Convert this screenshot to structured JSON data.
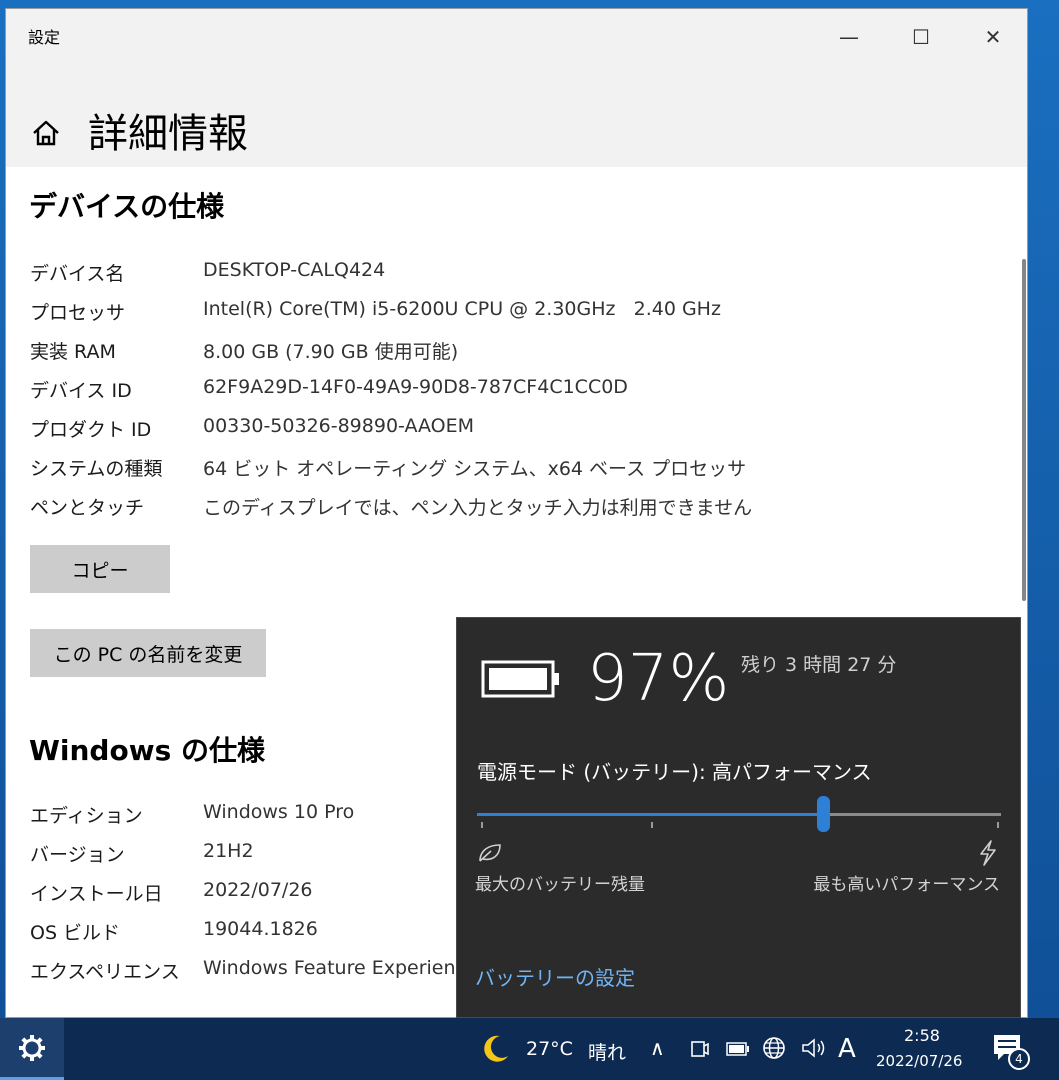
{
  "window": {
    "title": "設定",
    "minimize": "—",
    "maximize": "☐",
    "close": "✕"
  },
  "page": {
    "title": "詳細情報",
    "home_icon": "home-icon"
  },
  "device_spec": {
    "heading": "デバイスの仕様",
    "rows": [
      {
        "label": "デバイス名",
        "value": "DESKTOP-CALQ424"
      },
      {
        "label": "プロセッサ",
        "value": "Intel(R) Core(TM) i5-6200U CPU @ 2.30GHz   2.40 GHz"
      },
      {
        "label": "実装 RAM",
        "value": "8.00 GB (7.90 GB 使用可能)"
      },
      {
        "label": "デバイス ID",
        "value": "62F9A29D-14F0-49A9-90D8-787CF4C1CC0D"
      },
      {
        "label": "プロダクト ID",
        "value": "00330-50326-89890-AAOEM"
      },
      {
        "label": "システムの種類",
        "value": "64 ビット オペレーティング システム、x64 ベース プロセッサ"
      },
      {
        "label": "ペンとタッチ",
        "value": "このディスプレイでは、ペン入力とタッチ入力は利用できません"
      }
    ],
    "copy_button": "コピー",
    "rename_button": "この PC の名前を変更"
  },
  "windows_spec": {
    "heading": "Windows の仕様",
    "rows": [
      {
        "label": "エディション",
        "value": "Windows 10 Pro"
      },
      {
        "label": "バージョン",
        "value": "21H2"
      },
      {
        "label": "インストール日",
        "value": "2022/07/26"
      },
      {
        "label": "OS ビルド",
        "value": "19044.1826"
      },
      {
        "label": "エクスペリエンス",
        "value": "Windows Feature Experien"
      }
    ]
  },
  "battery_flyout": {
    "percent": "97%",
    "percent_value": 97,
    "remaining": "残り 3 時間 27 分",
    "power_mode_label": "電源モード (バッテリー): 高パフォーマンス",
    "slider_position": 0.66,
    "left_label": "最大のバッテリー残量",
    "right_label": "最も高いパフォーマンス",
    "settings_link": "バッテリーの設定",
    "accent_color": "#2e7fd6"
  },
  "taskbar": {
    "weather_temp": "27°C",
    "weather_condition": "晴れ",
    "show_hidden_icons": "∧",
    "ime_mode": "A",
    "time": "2:58",
    "date": "2022/07/26",
    "notification_count": "4"
  }
}
